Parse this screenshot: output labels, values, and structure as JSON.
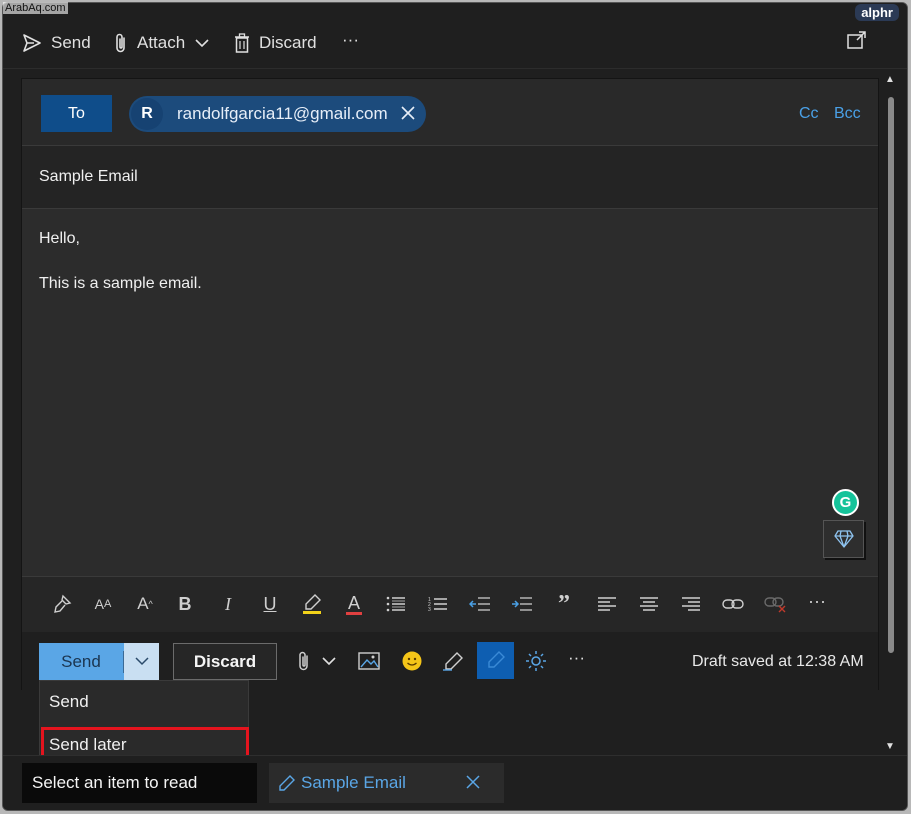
{
  "watermarks": {
    "left": "ArabAq.com",
    "right": "alphr"
  },
  "toolbar": {
    "send_label": "Send",
    "attach_label": "Attach",
    "discard_label": "Discard",
    "more_label": "···"
  },
  "recipients": {
    "to_label": "To",
    "chip_avatar": "R",
    "chip_email": "randolfgarcia11@gmail.com",
    "cc_label": "Cc",
    "bcc_label": "Bcc"
  },
  "subject": "Sample Email",
  "body": {
    "line1": "Hello,",
    "line2": "This is a sample email."
  },
  "grammarly_label": "G",
  "format_toolbar": {
    "icons": [
      "format-painter-icon",
      "font-size-icon",
      "grow-font-icon",
      "bold-icon",
      "italic-icon",
      "underline-icon",
      "highlight-icon",
      "font-color-icon",
      "bullets-icon",
      "numbering-icon",
      "decrease-indent-icon",
      "increase-indent-icon",
      "quote-icon",
      "align-left-icon",
      "align-center-icon",
      "align-right-icon",
      "link-icon",
      "unlink-icon",
      "more-icon"
    ],
    "bold": "B",
    "italic": "I",
    "underline": "U",
    "font_color": "A",
    "quote": "”",
    "more": "···"
  },
  "action_bar": {
    "send_label": "Send",
    "discard_label": "Discard",
    "more_label": "···",
    "draft_status": "Draft saved at 12:38 AM"
  },
  "send_menu": {
    "items": [
      {
        "label": "Send"
      },
      {
        "label": "Send later"
      }
    ]
  },
  "bottom_tabs": {
    "read_label": "Select an item to read",
    "draft_tab_label": "Sample Email"
  },
  "colors": {
    "accent": "#5aa6e6",
    "highlight_border": "#e4141e",
    "chip_bg": "#1c4b7c",
    "to_button": "#0f4d8a"
  }
}
